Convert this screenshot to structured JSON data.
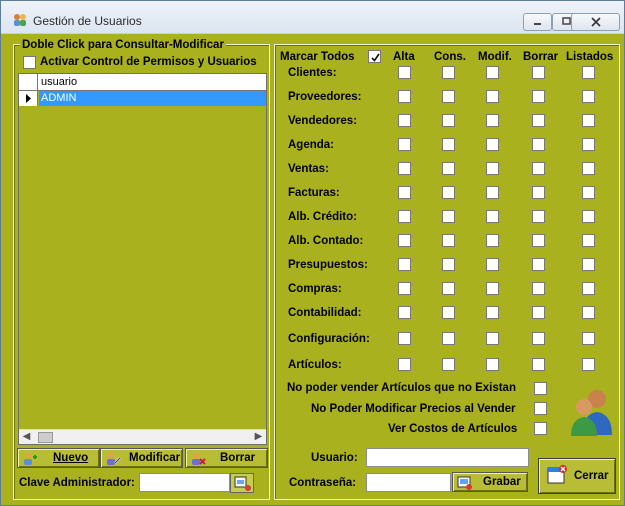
{
  "window": {
    "title": "Gestión de Usuarios",
    "controls": [
      "minimize",
      "maximize",
      "close"
    ]
  },
  "left_panel": {
    "group_title": "Doble Click para Consultar-Modificar",
    "checkbox_label": "Activar Control de Permisos y Usuarios",
    "grid": {
      "column_header": "usuario",
      "rows": [
        "ADMIN"
      ]
    },
    "buttons": {
      "new": "Nuevo",
      "modify": "Modificar",
      "delete": "Borrar"
    },
    "admin_key_label": "Clave Administrador:",
    "admin_key_value": ""
  },
  "permissions": {
    "mark_all_label": "Marcar Todos",
    "columns": [
      "Alta",
      "Cons.",
      "Modif.",
      "Borrar",
      "Listados"
    ],
    "rows": [
      "Clientes:",
      "Proveedores:",
      "Vendedores:",
      "Agenda:",
      "Ventas:",
      "Facturas:",
      "Alb. Crédito:",
      "Alb. Contado:",
      "Presupuestos:",
      "Compras:",
      "Contabilidad:",
      "Configuración:",
      "Artículos:"
    ],
    "extra_options": [
      "No poder vender Artículos que no Existan",
      "No Poder Modificar Precios al Vender",
      "Ver Costos de Artículos"
    ]
  },
  "credentials": {
    "user_label": "Usuario:",
    "password_label": "Contraseña:",
    "user_value": "",
    "password_value": "",
    "save_label": "Grabar",
    "close_label": "Cerrar"
  }
}
